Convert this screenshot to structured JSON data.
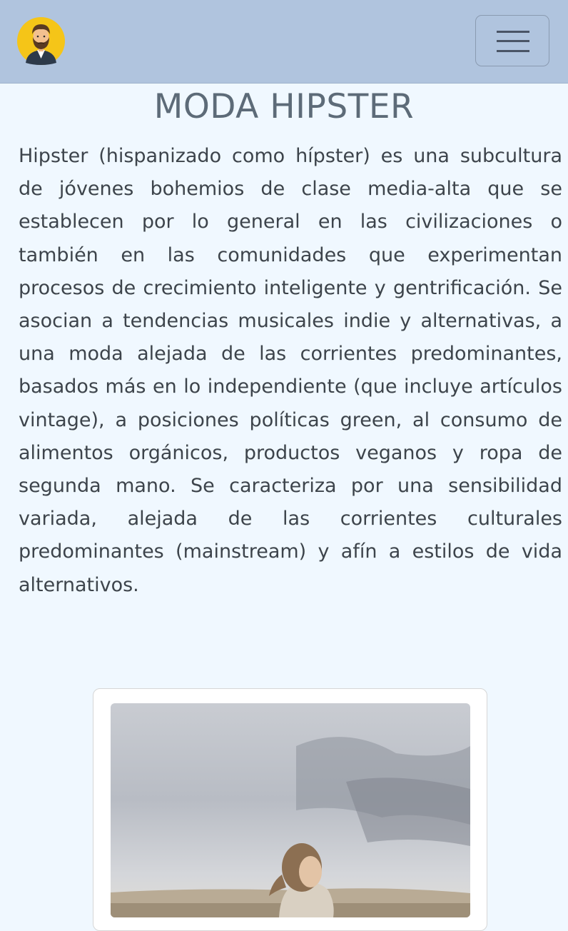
{
  "header": {
    "logo_icon": "bearded-man-avatar-icon",
    "menu_icon": "hamburger-menu-icon",
    "background": "#b0c4de"
  },
  "main": {
    "title": "MODA HIPSTER",
    "intro": "Hipster (hispanizado como hípster) es una subcultura de jóvenes bohemios de clase media-alta que se establecen por lo general en las civilizaciones o también en las comunidades que experimentan procesos de crecimiento inteligente y gentrificación. Se asocian a tendencias musicales indie y alternativas, a una moda alejada de las corrientes predominantes, basados más en lo independiente (que incluye artículos vintage), a posiciones políticas green, al consumo de alimentos orgánicos, productos veganos y ropa de segunda mano. Se caracteriza por una sensibilidad variada, alejada de las corrientes culturales predominantes (mainstream) y afín a estilos de vida alternativos.",
    "background": "#f0f8ff"
  }
}
